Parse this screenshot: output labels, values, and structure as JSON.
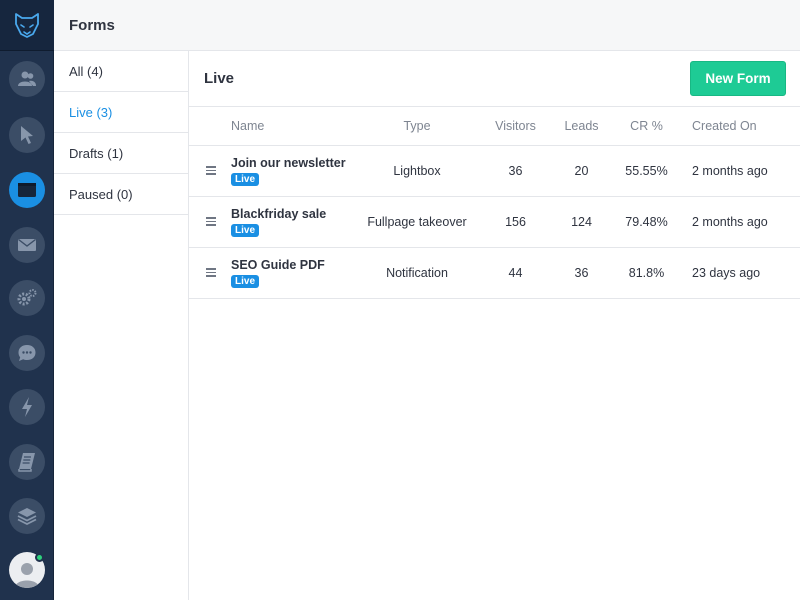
{
  "app": {
    "title": "Forms",
    "logo_icon": "bear-logo-icon",
    "accent_color": "#1a8fe3",
    "nav_color": "#20324d"
  },
  "nav": {
    "items": [
      {
        "icon": "contacts-icon"
      },
      {
        "icon": "cursor-icon"
      },
      {
        "icon": "forms-icon",
        "active": true
      },
      {
        "icon": "mail-icon"
      },
      {
        "icon": "settings-icon"
      },
      {
        "icon": "chat-icon"
      },
      {
        "icon": "lightning-icon"
      },
      {
        "icon": "book-icon"
      },
      {
        "icon": "layers-icon"
      }
    ],
    "avatar_icon": "user-avatar-icon",
    "online_color": "#2ed27d"
  },
  "filters": {
    "items": [
      {
        "label": "All (4)"
      },
      {
        "label": "Live (3)",
        "active": true
      },
      {
        "label": "Drafts (1)"
      },
      {
        "label": "Paused (0)"
      }
    ]
  },
  "main": {
    "title": "Live",
    "new_button": "New Form",
    "new_button_color": "#1ecb95"
  },
  "table": {
    "columns": [
      "Name",
      "Type",
      "Visitors",
      "Leads",
      "CR %",
      "Created On"
    ],
    "rows": [
      {
        "name": "Join our newsletter",
        "status": "Live",
        "type": "Lightbox",
        "visitors": "36",
        "leads": "20",
        "cr": "55.55%",
        "created": "2 months ago"
      },
      {
        "name": "Blackfriday sale",
        "status": "Live",
        "type": "Fullpage takeover",
        "visitors": "156",
        "leads": "124",
        "cr": "79.48%",
        "created": "2 months ago"
      },
      {
        "name": "SEO Guide PDF",
        "status": "Live",
        "type": "Notification",
        "visitors": "44",
        "leads": "36",
        "cr": "81.8%",
        "created": "23 days ago"
      }
    ]
  }
}
